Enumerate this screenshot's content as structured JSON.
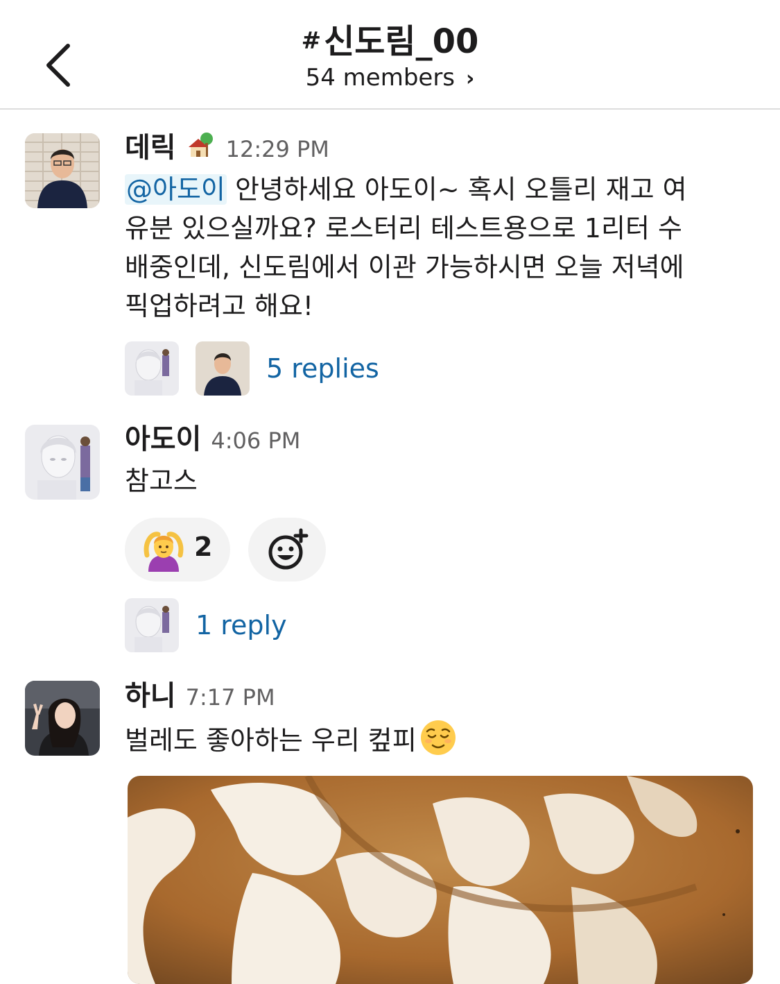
{
  "header": {
    "hash": "#",
    "channel_name": "신도림_00",
    "members": "54 members"
  },
  "messages": [
    {
      "author": "데릭",
      "status_icon": "house-with-tree-icon",
      "time": "12:29 PM",
      "mention": "@아도이",
      "text_line1": " 안녕하세요 아도이~ 혹시 오틀리 재고 여",
      "text_line2": "유분 있으실까요? 로스터리 테스트용으로 1리터 수",
      "text_line3": "배중인데, 신도림에서 이관 가능하시면 오늘 저녁에",
      "text_line4": "픽업하려고 해요!",
      "replies": "5 replies"
    },
    {
      "author": "아도이",
      "time": "4:06 PM",
      "text": "참고스",
      "reaction_emoji": "person-gesturing-ok-icon",
      "reaction_count": "2",
      "add_reaction_icon": "add-reaction-icon",
      "replies": "1 reply"
    },
    {
      "author": "하니",
      "time": "7:17 PM",
      "text": "벌레도 좋아하는 우리 컾피",
      "trailing_emoji": "relieved-face-icon",
      "attachment": "latte-art-photo"
    }
  ],
  "colors": {
    "link": "#1264a3",
    "mention_bg": "#e8f5fa",
    "text": "#1d1c1d",
    "muted": "#616061"
  }
}
